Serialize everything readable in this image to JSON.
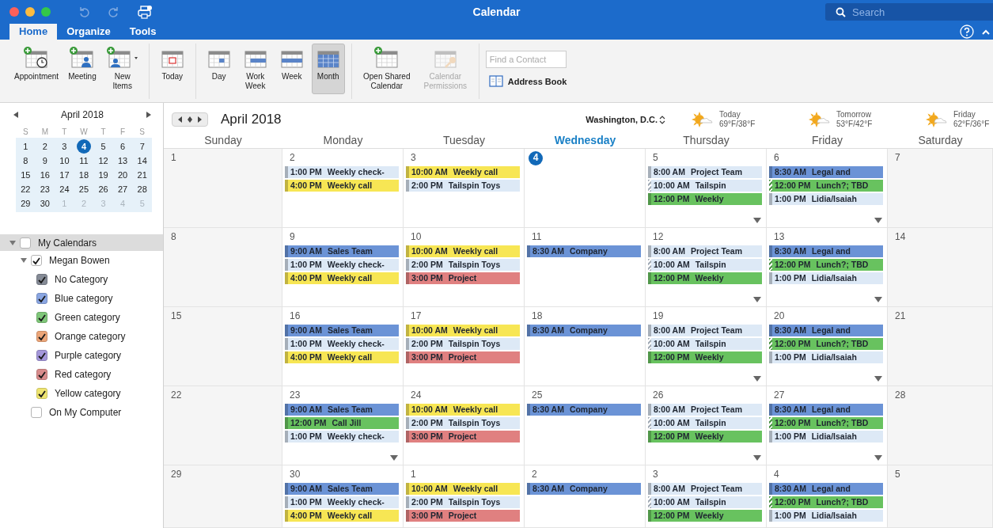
{
  "window": {
    "title": "Calendar",
    "search": {
      "placeholder": "Search"
    }
  },
  "tabs": [
    {
      "label": "Home",
      "selected": true
    },
    {
      "label": "Organize",
      "selected": false
    },
    {
      "label": "Tools",
      "selected": false
    }
  ],
  "ribbon": {
    "groups": [
      {
        "buttons": [
          {
            "label": "Appointment",
            "kind": "appointment"
          },
          {
            "label": "Meeting",
            "kind": "meeting"
          },
          {
            "label": "New Items",
            "kind": "new_items"
          }
        ]
      },
      {
        "buttons": [
          {
            "label": "Today",
            "kind": "today"
          }
        ]
      },
      {
        "buttons": [
          {
            "label": "Day",
            "kind": "day",
            "selected": false
          },
          {
            "label": "Work Week",
            "kind": "work_week",
            "selected": false
          },
          {
            "label": "Week",
            "kind": "week",
            "selected": false
          },
          {
            "label": "Month",
            "kind": "month",
            "selected": true
          }
        ]
      },
      {
        "buttons": [
          {
            "label": "Open Shared Calendar",
            "kind": "shared",
            "disabled": false
          },
          {
            "label": "Calendar Permissions",
            "kind": "permissions",
            "disabled": true
          }
        ]
      }
    ],
    "contact_search": {
      "placeholder": "Find a Contact"
    },
    "address_book": "Address Book"
  },
  "mini_calendar": {
    "title": "April 2018",
    "weekdays": [
      "S",
      "M",
      "T",
      "W",
      "T",
      "F",
      "S"
    ],
    "weeks": [
      [
        {
          "d": "1",
          "muted": false,
          "selected": false
        },
        {
          "d": "2",
          "muted": false,
          "selected": false
        },
        {
          "d": "3",
          "muted": false,
          "selected": false
        },
        {
          "d": "4",
          "muted": false,
          "selected": true
        },
        {
          "d": "5",
          "muted": false,
          "selected": false
        },
        {
          "d": "6",
          "muted": false,
          "selected": false
        },
        {
          "d": "7",
          "muted": false,
          "selected": false
        }
      ],
      [
        {
          "d": "8",
          "muted": false,
          "selected": false
        },
        {
          "d": "9",
          "muted": false,
          "selected": false
        },
        {
          "d": "10",
          "muted": false,
          "selected": false
        },
        {
          "d": "11",
          "muted": false,
          "selected": false
        },
        {
          "d": "12",
          "muted": false,
          "selected": false
        },
        {
          "d": "13",
          "muted": false,
          "selected": false
        },
        {
          "d": "14",
          "muted": false,
          "selected": false
        }
      ],
      [
        {
          "d": "15",
          "muted": false,
          "selected": false
        },
        {
          "d": "16",
          "muted": false,
          "selected": false
        },
        {
          "d": "17",
          "muted": false,
          "selected": false
        },
        {
          "d": "18",
          "muted": false,
          "selected": false
        },
        {
          "d": "19",
          "muted": false,
          "selected": false
        },
        {
          "d": "20",
          "muted": false,
          "selected": false
        },
        {
          "d": "21",
          "muted": false,
          "selected": false
        }
      ],
      [
        {
          "d": "22",
          "muted": false,
          "selected": false
        },
        {
          "d": "23",
          "muted": false,
          "selected": false
        },
        {
          "d": "24",
          "muted": false,
          "selected": false
        },
        {
          "d": "25",
          "muted": false,
          "selected": false
        },
        {
          "d": "26",
          "muted": false,
          "selected": false
        },
        {
          "d": "27",
          "muted": false,
          "selected": false
        },
        {
          "d": "28",
          "muted": false,
          "selected": false
        }
      ],
      [
        {
          "d": "29",
          "muted": false,
          "selected": false
        },
        {
          "d": "30",
          "muted": false,
          "selected": false
        },
        {
          "d": "1",
          "muted": true,
          "selected": false
        },
        {
          "d": "2",
          "muted": true,
          "selected": false
        },
        {
          "d": "3",
          "muted": true,
          "selected": false
        },
        {
          "d": "4",
          "muted": true,
          "selected": false
        },
        {
          "d": "5",
          "muted": true,
          "selected": false
        }
      ]
    ]
  },
  "calendars": [
    {
      "label": "My Calendars",
      "checked": false,
      "expanded": true,
      "children": [
        {
          "label": "Megan Bowen",
          "checked": true,
          "expanded": true,
          "children": [
            {
              "label": "No Category",
              "checked": true,
              "color": "#858b96"
            },
            {
              "label": "Blue category",
              "checked": true,
              "color": "#8aa6e2"
            },
            {
              "label": "Green category",
              "checked": true,
              "color": "#80c77a"
            },
            {
              "label": "Orange category",
              "checked": true,
              "color": "#eca679"
            },
            {
              "label": "Purple category",
              "checked": true,
              "color": "#a497da"
            },
            {
              "label": "Red category",
              "checked": true,
              "color": "#d88c8c"
            },
            {
              "label": "Yellow category",
              "checked": true,
              "color": "#eee470"
            }
          ]
        },
        {
          "label": "On My Computer",
          "checked": false
        }
      ]
    }
  ],
  "calendar": {
    "title": "April 2018",
    "location": "Washington, D.C.",
    "weather": [
      {
        "label": "Today",
        "temps": "69°F/38°F"
      },
      {
        "label": "Tomorrow",
        "temps": "53°F/42°F"
      },
      {
        "label": "Friday",
        "temps": "62°F/36°F"
      }
    ],
    "weekdays": [
      {
        "label": "Sunday",
        "today": false
      },
      {
        "label": "Monday",
        "today": false
      },
      {
        "label": "Tuesday",
        "today": false
      },
      {
        "label": "Wednesday",
        "today": true
      },
      {
        "label": "Thursday",
        "today": false
      },
      {
        "label": "Friday",
        "today": false
      },
      {
        "label": "Saturday",
        "today": false
      }
    ],
    "weeks": [
      {
        "days": [
          {
            "date": "1",
            "today": false,
            "more": false
          },
          {
            "date": "2",
            "today": false,
            "more": false,
            "events": [
              {
                "time": "1:00 PM",
                "title": "Weekly check-",
                "color": "#dde9f6",
                "tentative": false
              },
              {
                "time": "4:00 PM",
                "title": "Weekly call",
                "color": "#f7e654",
                "tentative": false
              }
            ]
          },
          {
            "date": "3",
            "today": false,
            "more": false,
            "events": [
              {
                "time": "10:00 AM",
                "title": "Weekly call",
                "color": "#f7e654",
                "tentative": false
              },
              {
                "time": "2:00 PM",
                "title": "Tailspin Toys",
                "color": "#dde9f6",
                "tentative": false
              }
            ]
          },
          {
            "date": "4",
            "today": true,
            "more": false
          },
          {
            "date": "5",
            "today": false,
            "more": true,
            "events": [
              {
                "time": "8:00 AM",
                "title": "Project Team",
                "color": "#dde9f6",
                "tentative": false
              },
              {
                "time": "10:00 AM",
                "title": "Tailspin",
                "color": "#dde9f6",
                "tentative": true
              },
              {
                "time": "12:00 PM",
                "title": "Weekly",
                "color": "#68c25f",
                "tentative": false
              }
            ]
          },
          {
            "date": "6",
            "today": false,
            "more": true,
            "events": [
              {
                "time": "8:30 AM",
                "title": "Legal and",
                "color": "#6b93d6",
                "tentative": false
              },
              {
                "time": "12:00 PM",
                "title": "Lunch?; TBD",
                "color": "#68c25f",
                "tentative": true
              },
              {
                "time": "1:00 PM",
                "title": "Lidia/Isaiah",
                "color": "#dde9f6",
                "tentative": false
              }
            ]
          },
          {
            "date": "7",
            "today": false,
            "more": false
          }
        ]
      },
      {
        "days": [
          {
            "date": "8",
            "today": false,
            "more": false
          },
          {
            "date": "9",
            "today": false,
            "more": false,
            "events": [
              {
                "time": "9:00 AM",
                "title": "Sales Team",
                "color": "#6b93d6",
                "tentative": false
              },
              {
                "time": "1:00 PM",
                "title": "Weekly check-",
                "color": "#dde9f6",
                "tentative": false
              },
              {
                "time": "4:00 PM",
                "title": "Weekly call",
                "color": "#f7e654",
                "tentative": false
              }
            ]
          },
          {
            "date": "10",
            "today": false,
            "more": false,
            "events": [
              {
                "time": "10:00 AM",
                "title": "Weekly call",
                "color": "#f7e654",
                "tentative": false
              },
              {
                "time": "2:00 PM",
                "title": "Tailspin Toys",
                "color": "#dde9f6",
                "tentative": false
              },
              {
                "time": "3:00 PM",
                "title": "Project",
                "color": "#e08080",
                "tentative": false
              }
            ]
          },
          {
            "date": "11",
            "today": false,
            "more": false,
            "events": [
              {
                "time": "8:30 AM",
                "title": "Company",
                "color": "#6b93d6",
                "tentative": false
              }
            ]
          },
          {
            "date": "12",
            "today": false,
            "more": true,
            "events": [
              {
                "time": "8:00 AM",
                "title": "Project Team",
                "color": "#dde9f6",
                "tentative": false
              },
              {
                "time": "10:00 AM",
                "title": "Tailspin",
                "color": "#dde9f6",
                "tentative": true
              },
              {
                "time": "12:00 PM",
                "title": "Weekly",
                "color": "#68c25f",
                "tentative": false
              }
            ]
          },
          {
            "date": "13",
            "today": false,
            "more": true,
            "events": [
              {
                "time": "8:30 AM",
                "title": "Legal and",
                "color": "#6b93d6",
                "tentative": false
              },
              {
                "time": "12:00 PM",
                "title": "Lunch?; TBD",
                "color": "#68c25f",
                "tentative": true
              },
              {
                "time": "1:00 PM",
                "title": "Lidia/Isaiah",
                "color": "#dde9f6",
                "tentative": false
              }
            ]
          },
          {
            "date": "14",
            "today": false,
            "more": false
          }
        ]
      },
      {
        "days": [
          {
            "date": "15",
            "today": false,
            "more": false
          },
          {
            "date": "16",
            "today": false,
            "more": false,
            "events": [
              {
                "time": "9:00 AM",
                "title": "Sales Team",
                "color": "#6b93d6",
                "tentative": false
              },
              {
                "time": "1:00 PM",
                "title": "Weekly check-",
                "color": "#dde9f6",
                "tentative": false
              },
              {
                "time": "4:00 PM",
                "title": "Weekly call",
                "color": "#f7e654",
                "tentative": false
              }
            ]
          },
          {
            "date": "17",
            "today": false,
            "more": false,
            "events": [
              {
                "time": "10:00 AM",
                "title": "Weekly call",
                "color": "#f7e654",
                "tentative": false
              },
              {
                "time": "2:00 PM",
                "title": "Tailspin Toys",
                "color": "#dde9f6",
                "tentative": false
              },
              {
                "time": "3:00 PM",
                "title": "Project",
                "color": "#e08080",
                "tentative": false
              }
            ]
          },
          {
            "date": "18",
            "today": false,
            "more": false,
            "events": [
              {
                "time": "8:30 AM",
                "title": "Company",
                "color": "#6b93d6",
                "tentative": false
              }
            ]
          },
          {
            "date": "19",
            "today": false,
            "more": true,
            "events": [
              {
                "time": "8:00 AM",
                "title": "Project Team",
                "color": "#dde9f6",
                "tentative": false
              },
              {
                "time": "10:00 AM",
                "title": "Tailspin",
                "color": "#dde9f6",
                "tentative": true
              },
              {
                "time": "12:00 PM",
                "title": "Weekly",
                "color": "#68c25f",
                "tentative": false
              }
            ]
          },
          {
            "date": "20",
            "today": false,
            "more": true,
            "events": [
              {
                "time": "8:30 AM",
                "title": "Legal and",
                "color": "#6b93d6",
                "tentative": false
              },
              {
                "time": "12:00 PM",
                "title": "Lunch?; TBD",
                "color": "#68c25f",
                "tentative": true
              },
              {
                "time": "1:00 PM",
                "title": "Lidia/Isaiah",
                "color": "#dde9f6",
                "tentative": false
              }
            ]
          },
          {
            "date": "21",
            "today": false,
            "more": false
          }
        ]
      },
      {
        "days": [
          {
            "date": "22",
            "today": false,
            "more": false
          },
          {
            "date": "23",
            "today": false,
            "more": true,
            "events": [
              {
                "time": "9:00 AM",
                "title": "Sales Team",
                "color": "#6b93d6",
                "tentative": false
              },
              {
                "time": "12:00 PM",
                "title": "Call Jill",
                "color": "#68c25f",
                "tentative": false
              },
              {
                "time": "1:00 PM",
                "title": "Weekly check-",
                "color": "#dde9f6",
                "tentative": false
              }
            ]
          },
          {
            "date": "24",
            "today": false,
            "more": false,
            "events": [
              {
                "time": "10:00 AM",
                "title": "Weekly call",
                "color": "#f7e654",
                "tentative": false
              },
              {
                "time": "2:00 PM",
                "title": "Tailspin Toys",
                "color": "#dde9f6",
                "tentative": false
              },
              {
                "time": "3:00 PM",
                "title": "Project",
                "color": "#e08080",
                "tentative": false
              }
            ]
          },
          {
            "date": "25",
            "today": false,
            "more": false,
            "events": [
              {
                "time": "8:30 AM",
                "title": "Company",
                "color": "#6b93d6",
                "tentative": false
              }
            ]
          },
          {
            "date": "26",
            "today": false,
            "more": true,
            "events": [
              {
                "time": "8:00 AM",
                "title": "Project Team",
                "color": "#dde9f6",
                "tentative": false
              },
              {
                "time": "10:00 AM",
                "title": "Tailspin",
                "color": "#dde9f6",
                "tentative": true
              },
              {
                "time": "12:00 PM",
                "title": "Weekly",
                "color": "#68c25f",
                "tentative": false
              }
            ]
          },
          {
            "date": "27",
            "today": false,
            "more": true,
            "events": [
              {
                "time": "8:30 AM",
                "title": "Legal and",
                "color": "#6b93d6",
                "tentative": false
              },
              {
                "time": "12:00 PM",
                "title": "Lunch?; TBD",
                "color": "#68c25f",
                "tentative": true
              },
              {
                "time": "1:00 PM",
                "title": "Lidia/Isaiah",
                "color": "#dde9f6",
                "tentative": false
              }
            ]
          },
          {
            "date": "28",
            "today": false,
            "more": false
          }
        ]
      },
      {
        "days": [
          {
            "date": "29",
            "today": false,
            "more": false
          },
          {
            "date": "30",
            "today": false,
            "more": false,
            "events": [
              {
                "time": "9:00 AM",
                "title": "Sales Team",
                "color": "#6b93d6",
                "tentative": false
              },
              {
                "time": "1:00 PM",
                "title": "Weekly check-",
                "color": "#dde9f6",
                "tentative": false
              },
              {
                "time": "4:00 PM",
                "title": "Weekly call",
                "color": "#f7e654",
                "tentative": false
              }
            ]
          },
          {
            "date": "1",
            "today": false,
            "more": false,
            "events": [
              {
                "time": "10:00 AM",
                "title": "Weekly call",
                "color": "#f7e654",
                "tentative": false
              },
              {
                "time": "2:00 PM",
                "title": "Tailspin Toys",
                "color": "#dde9f6",
                "tentative": false
              },
              {
                "time": "3:00 PM",
                "title": "Project",
                "color": "#e08080",
                "tentative": false
              }
            ]
          },
          {
            "date": "2",
            "today": false,
            "more": false,
            "events": [
              {
                "time": "8:30 AM",
                "title": "Company",
                "color": "#6b93d6",
                "tentative": false
              }
            ]
          },
          {
            "date": "3",
            "today": false,
            "more": false,
            "events": [
              {
                "time": "8:00 AM",
                "title": "Project Team",
                "color": "#dde9f6",
                "tentative": false
              },
              {
                "time": "10:00 AM",
                "title": "Tailspin",
                "color": "#dde9f6",
                "tentative": true
              },
              {
                "time": "12:00 PM",
                "title": "Weekly",
                "color": "#68c25f",
                "tentative": false
              }
            ]
          },
          {
            "date": "4",
            "today": false,
            "more": false,
            "events": [
              {
                "time": "8:30 AM",
                "title": "Legal and",
                "color": "#6b93d6",
                "tentative": false
              },
              {
                "time": "12:00 PM",
                "title": "Lunch?; TBD",
                "color": "#68c25f",
                "tentative": true
              },
              {
                "time": "1:00 PM",
                "title": "Lidia/Isaiah",
                "color": "#dde9f6",
                "tentative": false
              }
            ]
          },
          {
            "date": "5",
            "today": false,
            "more": false
          }
        ]
      }
    ]
  }
}
